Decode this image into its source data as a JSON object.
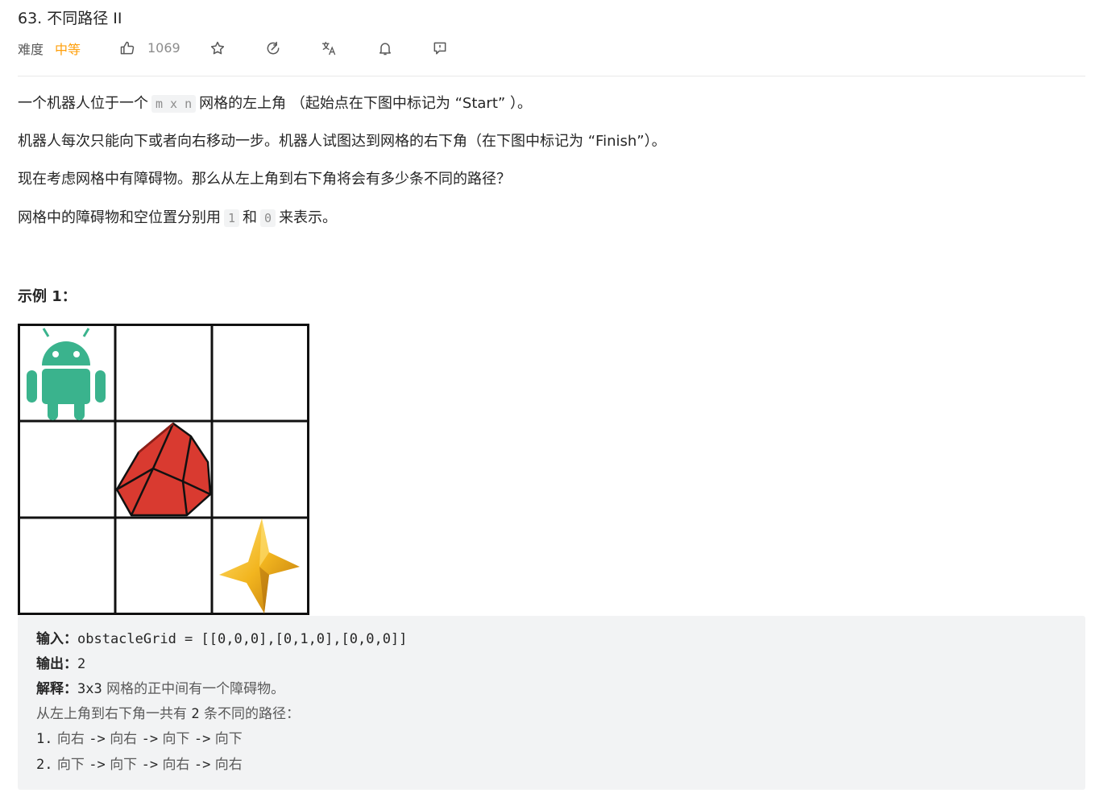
{
  "problem": {
    "title": "63. 不同路径 II",
    "difficulty_label": "难度",
    "difficulty": "中等",
    "likes": "1069"
  },
  "toolbar_icons": [
    "thumbs-up-icon",
    "star-icon",
    "share-icon",
    "translate-icon",
    "bell-icon",
    "feedback-icon"
  ],
  "description": {
    "p1_before": "一个机器人位于一个",
    "p1_code": "m x n",
    "p1_after": "网格的左上角 （起始点在下图中标记为 “Start” ）。",
    "p2": "机器人每次只能向下或者向右移动一步。机器人试图达到网格的右下角（在下图中标记为 “Finish”）。",
    "p3": "现在考虑网格中有障碍物。那么从左上角到右下角将会有多少条不同的路径？",
    "p4_before": "网格中的障碍物和空位置分别用",
    "p4_code1": "1",
    "p4_mid": "和",
    "p4_code2": "0",
    "p4_after": "来表示。"
  },
  "example": {
    "title": "示例 1：",
    "grid": [
      [
        "robot",
        "",
        ""
      ],
      [
        "",
        "obstacle",
        ""
      ],
      [
        "",
        "",
        "star"
      ]
    ],
    "input_label": "输入：",
    "input_value": "obstacleGrid = [[0,0,0],[0,1,0],[0,0,0]]",
    "output_label": "输出：",
    "output_value": "2",
    "explain_label": "解释：",
    "explain_mono": "3x3",
    "explain_text": " 网格的正中间有一个障碍物。",
    "line4_a": "从左上角到右下角一共有 ",
    "line4_num": "2",
    "line4_b": " 条不同的路径：",
    "path1_num": "1.",
    "path1_steps": [
      "向右",
      "向右",
      "向下",
      "向下"
    ],
    "path2_num": "2.",
    "path2_steps": [
      "向下",
      "向下",
      "向右",
      "向右"
    ],
    "arrow": "->"
  },
  "colors": {
    "difficulty": "#ff9f0a",
    "robot": "#3ab38d",
    "obstacle": "#d93a30",
    "star": "#f2b51f",
    "code_bg": "#f2f3f4"
  }
}
